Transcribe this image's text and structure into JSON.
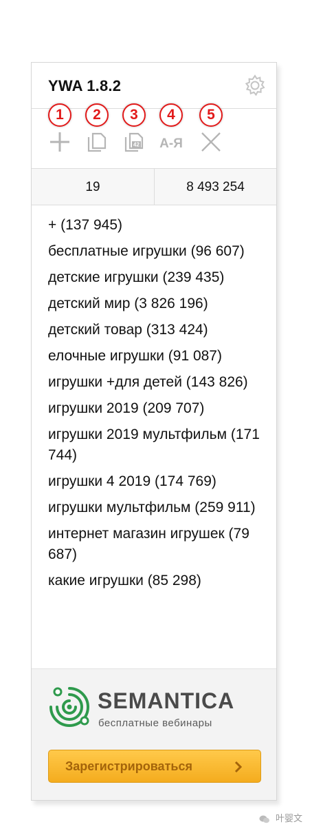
{
  "header": {
    "title": "YWA 1.8.2",
    "settings_icon": "gear-icon"
  },
  "toolbar": {
    "items": [
      {
        "badge": "1",
        "icon": "plus-icon"
      },
      {
        "badge": "2",
        "icon": "copy-icon"
      },
      {
        "badge": "3",
        "icon": "copy-with-frequency-icon"
      },
      {
        "badge": "4",
        "icon": "sort-alpha-icon"
      },
      {
        "badge": "5",
        "icon": "close-icon"
      }
    ],
    "sort_icon_text": "А-Я"
  },
  "counts": {
    "phrases": "19",
    "total": "8 493 254"
  },
  "keywords": [
    "+ (137 945)",
    "бесплатные игрушки (96 607)",
    "детские игрушки (239 435)",
    "детский мир (3 826 196)",
    "детский товар (313 424)",
    "елочные игрушки (91 087)",
    "игрушки +для детей (143 826)",
    "игрушки 2019 (209 707)",
    "игрушки 2019 мультфильм (171 744)",
    "игрушки 4 2019 (174 769)",
    "игрушки мультфильм (259 911)",
    "интернет магазин игрушек (79 687)",
    "какие игрушки (85 298)"
  ],
  "promo": {
    "brand_name": "SEMANTICA",
    "brand_sub": "бесплатные вебинары",
    "register_label": "Зарегистрироваться",
    "accent_color": "#2e9a4c",
    "button_color": "#f7b733"
  },
  "watermark": {
    "text": "叶婴文"
  }
}
